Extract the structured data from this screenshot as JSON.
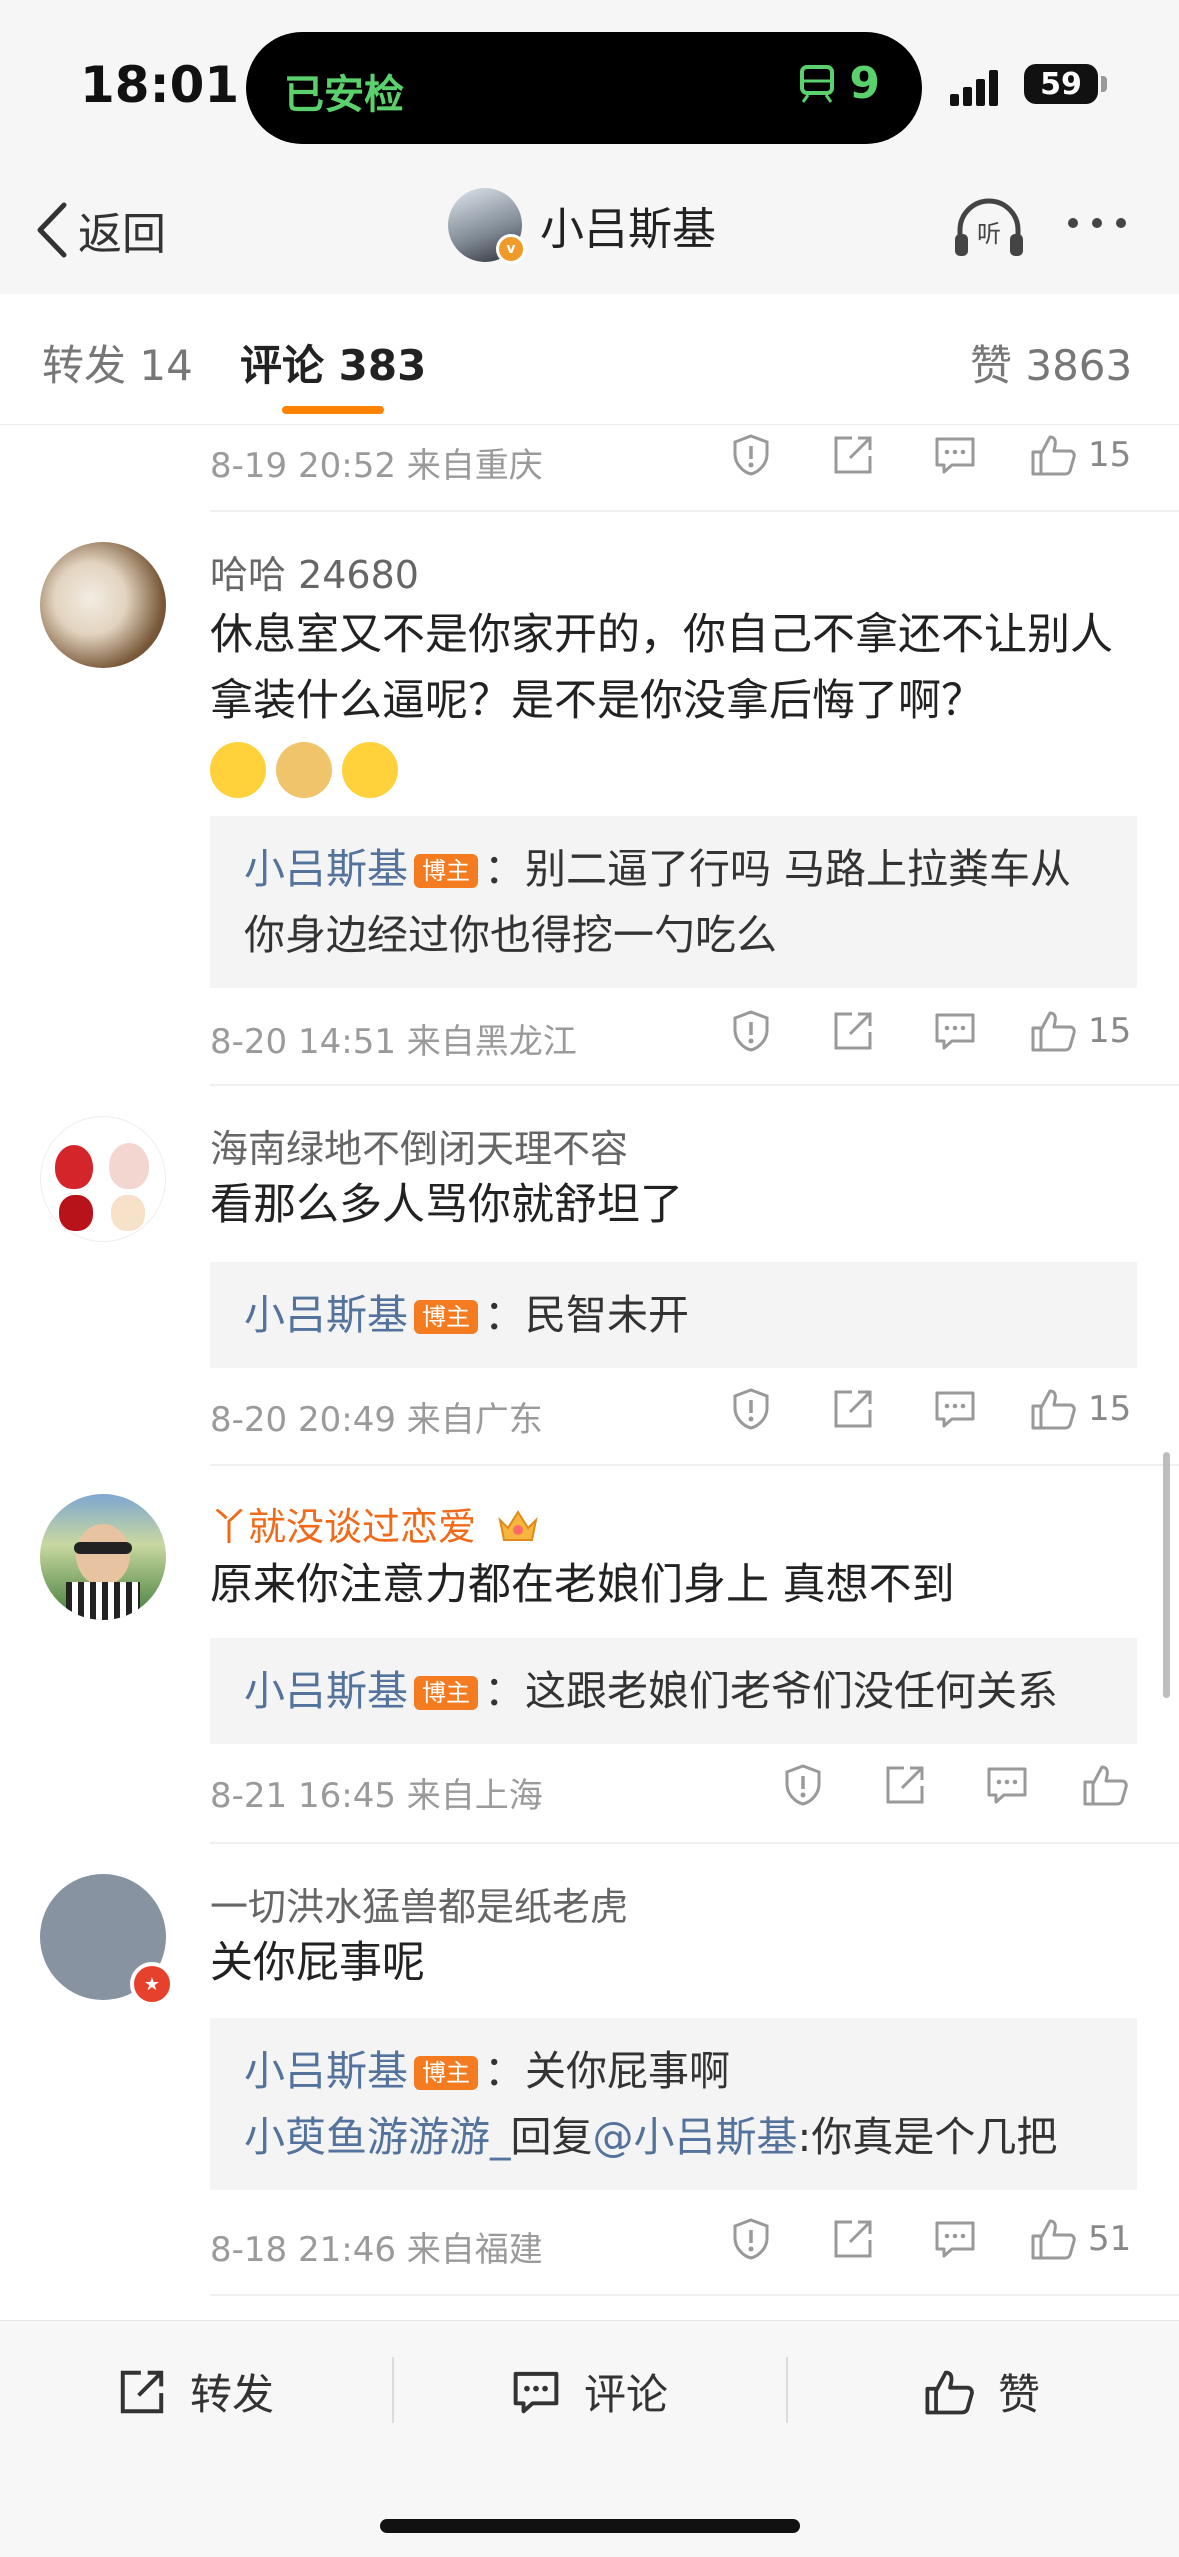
{
  "status_bar": {
    "time": "18:01",
    "island_left": "已安检",
    "island_right": "9",
    "battery": "59"
  },
  "nav": {
    "back_label": "返回",
    "title": "小吕斯基"
  },
  "tabs": {
    "repost": "转发 14",
    "comments": "评论 383",
    "likes": "赞 3863"
  },
  "top_partial": {
    "meta": "8-19 20:52  来自重庆",
    "likes": "15"
  },
  "comments": [
    {
      "user": "哈哈 24680",
      "text": "休息室又不是你家开的，你自己不拿还不让别人拿装什么逼呢？是不是你没拿后悔了啊？",
      "reply_user": "小吕斯基",
      "reply_badge": "博主",
      "reply_text": "：别二逼了行吗 马路上拉粪车从你身边经过你也得挖一勺吃么",
      "meta": "8-20 14:51  来自黑龙江",
      "likes": "15"
    },
    {
      "user": "海南绿地不倒闭天理不容",
      "text": "看那么多人骂你就舒坦了",
      "reply_user": "小吕斯基",
      "reply_badge": "博主",
      "reply_text": "：民智未开",
      "meta": "8-20 20:49  来自广东",
      "likes": "15"
    },
    {
      "user": "丫就没谈过恋爱",
      "text": "原来你注意力都在老娘们身上 真想不到",
      "reply_user": "小吕斯基",
      "reply_badge": "博主",
      "reply_text": "：这跟老娘们老爷们没任何关系",
      "meta": "8-21 16:45  来自上海",
      "likes": ""
    },
    {
      "user": "一切洪水猛兽都是纸老虎",
      "text": "关你屁事呢",
      "reply_user": "小吕斯基",
      "reply_badge": "博主",
      "reply_text": "：关你屁事啊",
      "reply2_user": "小萸鱼游游游_",
      "reply2_mid": "回复",
      "reply2_at": "@小吕斯基",
      "reply2_text": ":你真是个几把",
      "meta": "8-18 21:46  来自福建",
      "likes": "51"
    }
  ],
  "bottom_bar": {
    "repost": "转发",
    "comment": "评论",
    "like": "赞"
  },
  "colors": {
    "accent": "#ff8200",
    "reply_name": "#53739c",
    "host_badge": "#f47b20",
    "vip_name": "#f06a1a"
  }
}
